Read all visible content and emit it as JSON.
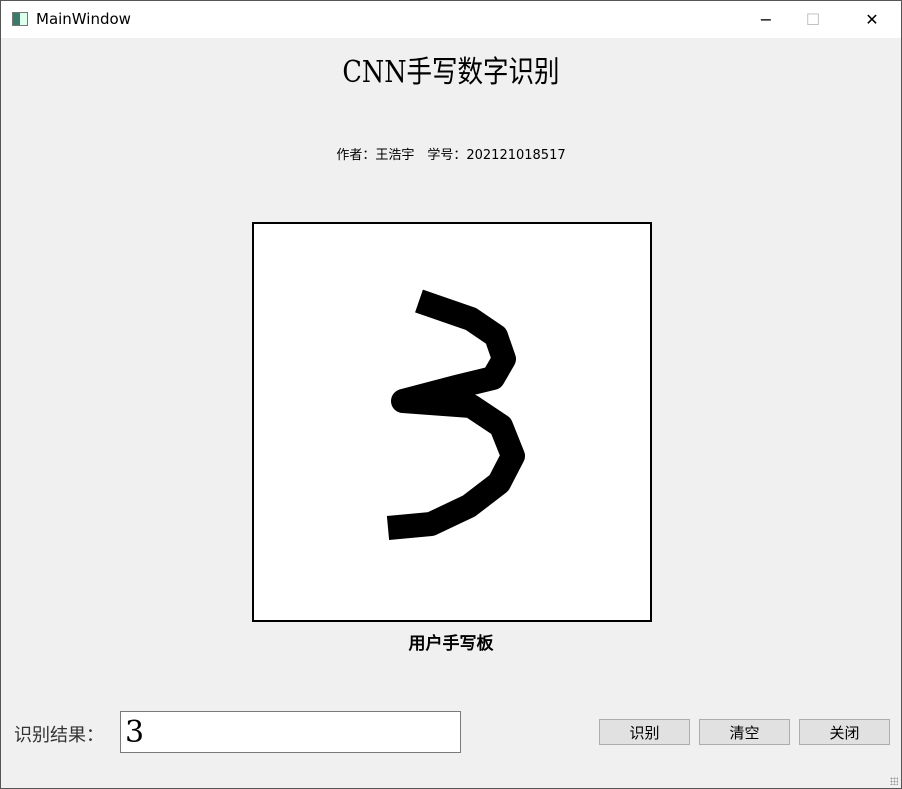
{
  "window": {
    "title": "MainWindow",
    "minimize": "−",
    "maximize": "☐",
    "close": "✕"
  },
  "header": {
    "title": "CNN手写数字识别",
    "author": "作者：王浩宇　学号：202121018517"
  },
  "canvas": {
    "label": "用户手写板",
    "drawn_digit": "3"
  },
  "result": {
    "label": "识别结果：",
    "value": "3"
  },
  "buttons": {
    "recognize": "识别",
    "clear": "清空",
    "close": "关闭"
  }
}
